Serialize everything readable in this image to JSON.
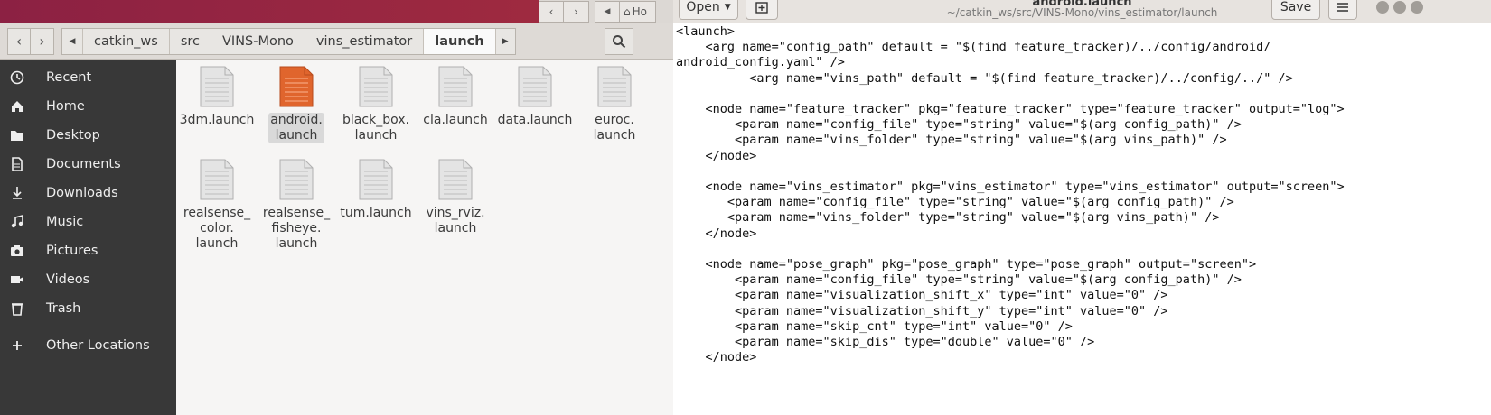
{
  "files": {
    "nav": {
      "back_icon": "chevron-left-icon",
      "forward_icon": "chevron-right-icon"
    },
    "breadcrumbs": [
      "catkin_ws",
      "src",
      "VINS-Mono",
      "vins_estimator",
      "launch"
    ],
    "sidebar": [
      {
        "label": "Recent",
        "icon": "clock-icon"
      },
      {
        "label": "Home",
        "icon": "home-icon"
      },
      {
        "label": "Desktop",
        "icon": "folder-icon"
      },
      {
        "label": "Documents",
        "icon": "document-icon"
      },
      {
        "label": "Downloads",
        "icon": "download-icon"
      },
      {
        "label": "Music",
        "icon": "music-icon"
      },
      {
        "label": "Pictures",
        "icon": "camera-icon"
      },
      {
        "label": "Videos",
        "icon": "video-icon"
      },
      {
        "label": "Trash",
        "icon": "trash-icon"
      },
      {
        "label": "Other Locations",
        "icon": "plus-icon"
      }
    ],
    "items": [
      {
        "name": "3dm.launch"
      },
      {
        "name": "android.\nlaunch",
        "selected": true
      },
      {
        "name": "black_box.\nlaunch"
      },
      {
        "name": "cla.launch"
      },
      {
        "name": "data.launch"
      },
      {
        "name": "euroc.\nlaunch"
      },
      {
        "name": "realsense_\ncolor.\nlaunch"
      },
      {
        "name": "realsense_\nfisheye.\nlaunch"
      },
      {
        "name": "tum.launch"
      },
      {
        "name": "vins_rviz.\nlaunch"
      }
    ],
    "colors": {
      "selected_file": "#e0652d",
      "sidebar_bg": "#383838"
    }
  },
  "behind_window": {
    "label": "Ho"
  },
  "gedit": {
    "title": "android.launch",
    "subtitle": "~/catkin_ws/src/VINS-Mono/vins_estimator/launch",
    "open_label": "Open",
    "save_label": "Save",
    "lines": [
      "<launch>",
      "    <arg name=\"config_path\" default = \"$(find feature_tracker)/../config/android/",
      "android_config.yaml\" />",
      "\t  <arg name=\"vins_path\" default = \"$(find feature_tracker)/../config/../\" />",
      "",
      "    <node name=\"feature_tracker\" pkg=\"feature_tracker\" type=\"feature_tracker\" output=\"log\">",
      "        <param name=\"config_file\" type=\"string\" value=\"$(arg config_path)\" />",
      "        <param name=\"vins_folder\" type=\"string\" value=\"$(arg vins_path)\" />",
      "    </node>",
      "",
      "    <node name=\"vins_estimator\" pkg=\"vins_estimator\" type=\"vins_estimator\" output=\"screen\">",
      "       <param name=\"config_file\" type=\"string\" value=\"$(arg config_path)\" />",
      "       <param name=\"vins_folder\" type=\"string\" value=\"$(arg vins_path)\" />",
      "    </node>",
      "",
      "    <node name=\"pose_graph\" pkg=\"pose_graph\" type=\"pose_graph\" output=\"screen\">",
      "        <param name=\"config_file\" type=\"string\" value=\"$(arg config_path)\" />",
      "        <param name=\"visualization_shift_x\" type=\"int\" value=\"0\" />",
      "        <param name=\"visualization_shift_y\" type=\"int\" value=\"0\" />",
      "        <param name=\"skip_cnt\" type=\"int\" value=\"0\" />",
      "        <param name=\"skip_dis\" type=\"double\" value=\"0\" />",
      "    </node>"
    ]
  }
}
